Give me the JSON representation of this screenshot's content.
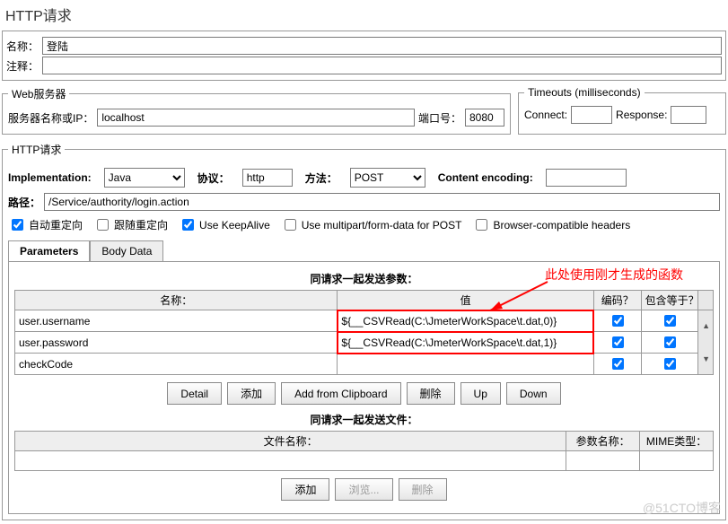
{
  "title": "HTTP请求",
  "name": {
    "label": "名称：",
    "value": "登陆"
  },
  "comment": {
    "label": "注释：",
    "value": ""
  },
  "webserver": {
    "legend": "Web服务器",
    "hostLabel": "服务器名称或IP：",
    "hostValue": "localhost",
    "portLabel": "端口号：",
    "portValue": "8080"
  },
  "timeouts": {
    "legend": "Timeouts (milliseconds)",
    "connectLabel": "Connect:",
    "connectValue": "",
    "responseLabel": "Response:",
    "responseValue": ""
  },
  "httpreq": {
    "legend": "HTTP请求",
    "implLabel": "Implementation:",
    "implValue": "Java",
    "protoLabel": "协议：",
    "protoValue": "http",
    "methodLabel": "方法：",
    "methodValue": "POST",
    "encLabel": "Content encoding:",
    "encValue": "",
    "pathLabel": "路径：",
    "pathValue": "/Service/authority/login.action"
  },
  "checks": {
    "autoRedirect": "自动重定向",
    "followRedirect": "跟随重定向",
    "keepAlive": "Use KeepAlive",
    "multipart": "Use multipart/form-data for POST",
    "browserCompat": "Browser-compatible headers"
  },
  "tabs": {
    "params": "Parameters",
    "body": "Body Data"
  },
  "paramsSection": {
    "header": "同请求一起发送参数：",
    "annotation": "此处使用刚才生成的函数",
    "cols": {
      "name": "名称：",
      "value": "值",
      "encode": "编码？",
      "include": "包含等于？"
    },
    "rows": [
      {
        "name": "user.username",
        "value": "${__CSVRead(C:\\JmeterWorkSpace\\t.dat,0)}",
        "encode": true,
        "include": true
      },
      {
        "name": "user.password",
        "value": "${__CSVRead(C:\\JmeterWorkSpace\\t.dat,1)}",
        "encode": true,
        "include": true
      },
      {
        "name": "checkCode",
        "value": "",
        "encode": true,
        "include": true
      }
    ],
    "buttons": {
      "detail": "Detail",
      "add": "添加",
      "clipboard": "Add from Clipboard",
      "delete": "删除",
      "up": "Up",
      "down": "Down"
    }
  },
  "filesSection": {
    "header": "同请求一起发送文件：",
    "cols": {
      "path": "文件名称：",
      "param": "参数名称：",
      "mime": "MIME类型："
    },
    "buttons": {
      "add": "添加",
      "browse": "浏览...",
      "delete": "删除"
    }
  },
  "watermark": "@51CTO博客"
}
